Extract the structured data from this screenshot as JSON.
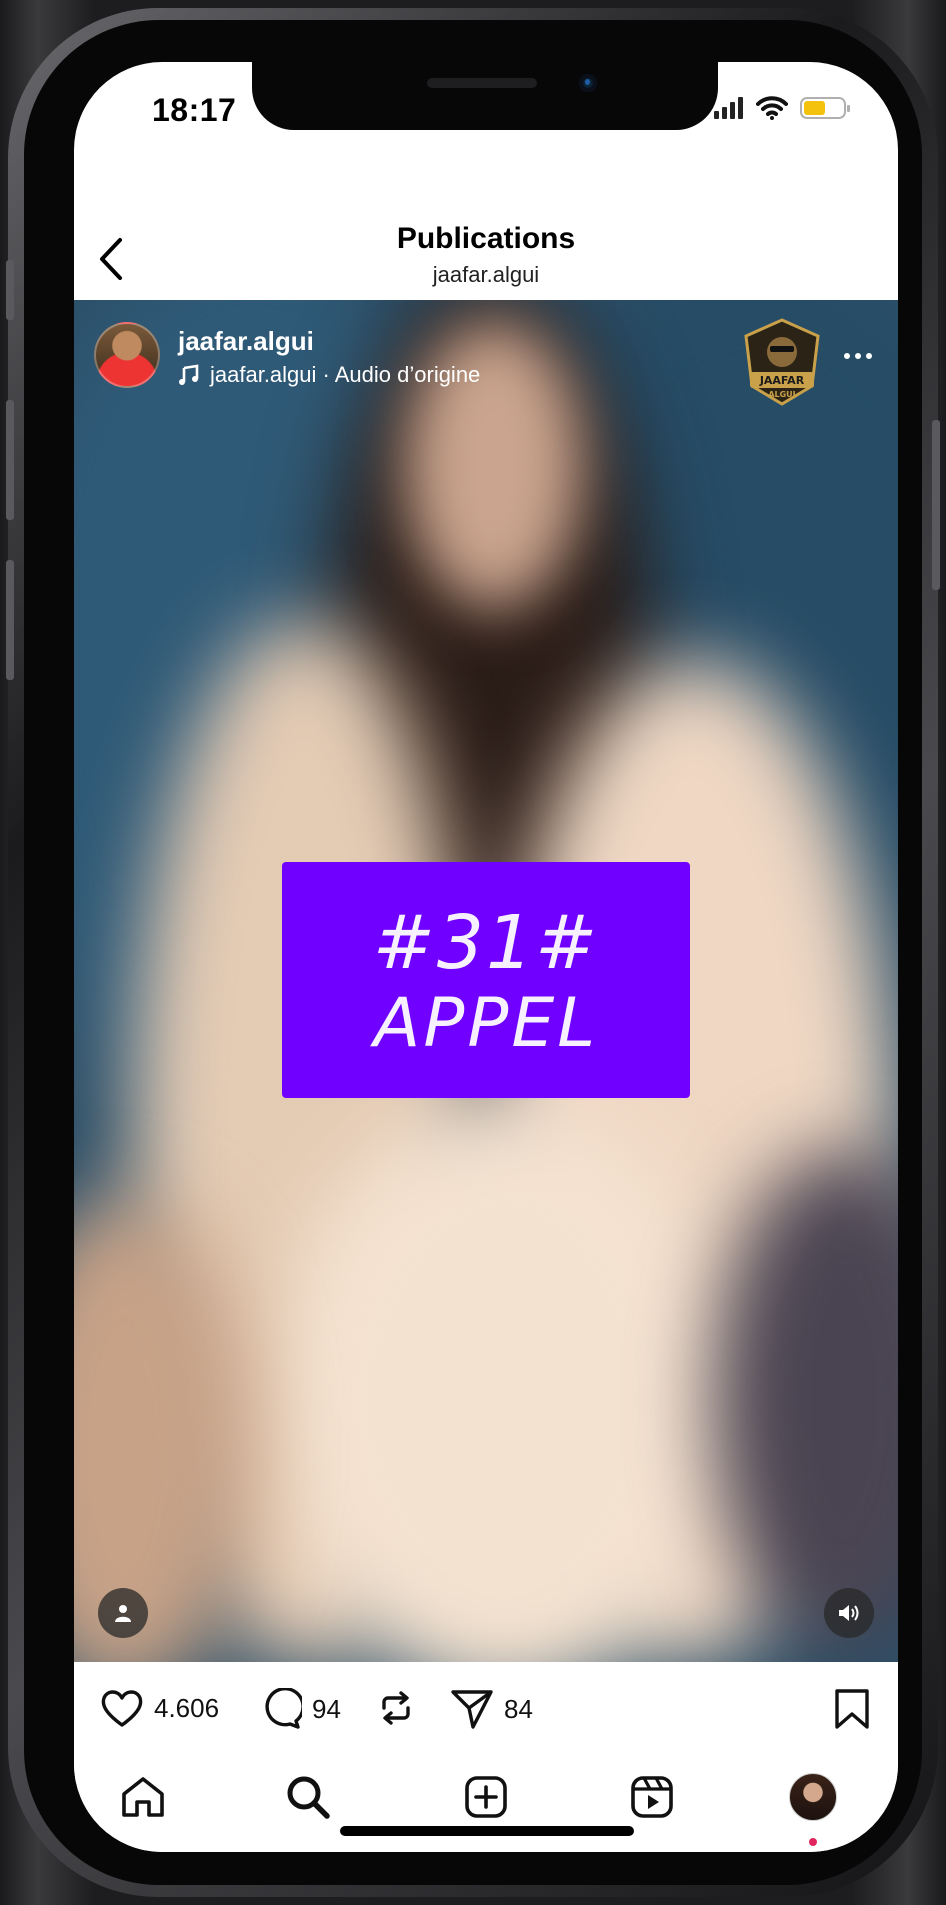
{
  "status_bar": {
    "time": "18:17",
    "battery_level": 0.55,
    "battery_color": "#f4c20d"
  },
  "header": {
    "title": "Publications",
    "subtitle": "jaafar.algui"
  },
  "post": {
    "username": "jaafar.algui",
    "audio": "jaafar.algui · Audio d’origine",
    "logo_text": "JAAFAR",
    "logo_subtext": "ALGUI",
    "card": {
      "line1": "#31#",
      "line2": "APPEL",
      "color": "#7000ff"
    }
  },
  "actions": {
    "likes": "4.606",
    "comments": "94",
    "shares": "84"
  },
  "tabs": [
    "home",
    "search",
    "create",
    "reels",
    "profile"
  ]
}
